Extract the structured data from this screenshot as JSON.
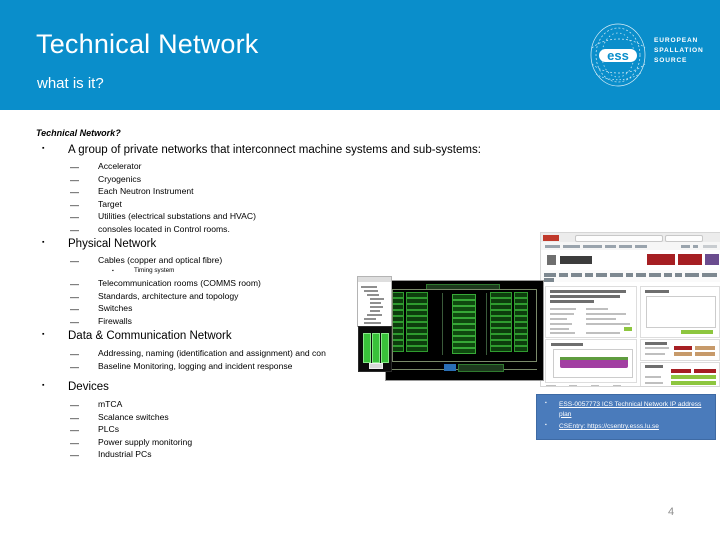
{
  "header": {
    "title": "Technical Network",
    "subtitle": "what is it?",
    "background_color": "#0a8ecb",
    "logo": {
      "mark_text": "ess",
      "lines": [
        "EUROPEAN",
        "SPALLATION",
        "SOURCE"
      ]
    }
  },
  "content": {
    "section_heading": "Technical Network?",
    "blocks": [
      {
        "level": 1,
        "bullet": "▪",
        "text": "A group of private networks that interconnect  machine systems and sub-systems:",
        "children": [
          {
            "level": 2,
            "bullet": "—",
            "text": "Accelerator"
          },
          {
            "level": 2,
            "bullet": "—",
            "text": "Cryogenics"
          },
          {
            "level": 2,
            "bullet": "—",
            "text": "Each Neutron Instrument"
          },
          {
            "level": 2,
            "bullet": "—",
            "text": "Target"
          },
          {
            "level": 2,
            "bullet": "—",
            "text": "Utilities (electrical substations and HVAC)"
          },
          {
            "level": 2,
            "bullet": "—",
            "text": "consoles located in Control rooms."
          }
        ]
      },
      {
        "level": 1,
        "bullet": "▪",
        "text": "Physical Network",
        "children": [
          {
            "level": 2,
            "bullet": "—",
            "text": "Cables (copper and optical fibre)"
          },
          {
            "level": 3,
            "bullet": "▪",
            "text": "Timing system"
          },
          {
            "level": 2,
            "bullet": "—",
            "text": "Telecommunication rooms (COMMS room)"
          },
          {
            "level": 2,
            "bullet": "—",
            "text": "Standards, architecture and topology"
          },
          {
            "level": 2,
            "bullet": "—",
            "text": "Switches"
          },
          {
            "level": 2,
            "bullet": "—",
            "text": "Firewalls"
          }
        ]
      },
      {
        "level": 1,
        "bullet": "▪",
        "text": "Data & Communication Network",
        "children": [
          {
            "level": 2,
            "bullet": "—",
            "text": "Addressing, naming (identification and assignment) and con"
          },
          {
            "level": 2,
            "bullet": "—",
            "text": "Baseline Monitoring, logging and incident response"
          }
        ]
      },
      {
        "level": 1,
        "bullet": "▪",
        "text": "Devices",
        "children": [
          {
            "level": 2,
            "bullet": "—",
            "text": "mTCA"
          },
          {
            "level": 2,
            "bullet": "—",
            "text": "Scalance switches"
          },
          {
            "level": 2,
            "bullet": "—",
            "text": "PLCs"
          },
          {
            "level": 2,
            "bullet": "—",
            "text": "Power supply monitoring"
          },
          {
            "level": 2,
            "bullet": "—",
            "text": "Industrial PCs"
          }
        ]
      }
    ]
  },
  "link_box": {
    "background_color": "#4a7bbb",
    "bullet": "▪",
    "items": [
      {
        "text": "ESS-0057773 ICS Technical Network IP address plan"
      },
      {
        "text": "CSEntry: https://csentry.esss.lu.se"
      }
    ]
  },
  "images": {
    "dashboard": "monitoring-dashboard-browser-screenshot",
    "cad": "network-topology-diagram-dark-screenshot",
    "tree": "file-tree-panel-screenshot",
    "rack": "equipment-rack-photo"
  },
  "page_number": "4"
}
